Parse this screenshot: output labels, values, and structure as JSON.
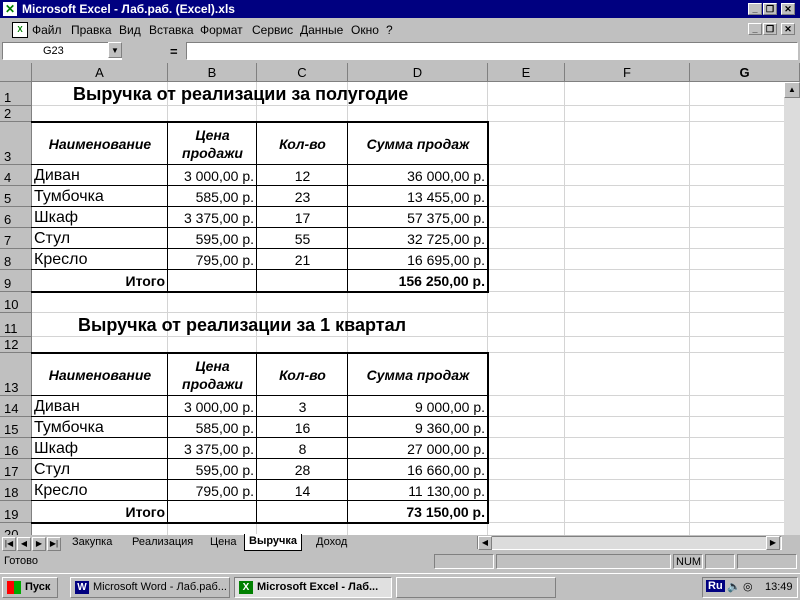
{
  "window": {
    "title": "Microsoft Excel - Лаб.раб. (Excel).xls"
  },
  "menu": [
    "Файл",
    "Правка",
    "Вид",
    "Вставка",
    "Формат",
    "Сервис",
    "Данные",
    "Окно",
    "?"
  ],
  "formula": {
    "cell_ref": "G23",
    "eq": "=",
    "value": ""
  },
  "columns": [
    "A",
    "B",
    "C",
    "D",
    "E",
    "F",
    "G"
  ],
  "rows": [
    "1",
    "2",
    "3",
    "4",
    "5",
    "6",
    "7",
    "8",
    "9",
    "10",
    "11",
    "12",
    "13",
    "14",
    "15",
    "16",
    "17",
    "18",
    "19",
    "20"
  ],
  "table1": {
    "title": "Выручка от реализации за полугодие",
    "headers": [
      "Наименование",
      "Цена продажи",
      "Кол-во",
      "Сумма  продаж"
    ],
    "rows": [
      [
        "Диван",
        "3 000,00 р.",
        "12",
        "36 000,00 р."
      ],
      [
        "Тумбочка",
        "585,00 р.",
        "23",
        "13 455,00 р."
      ],
      [
        "Шкаф",
        "3 375,00 р.",
        "17",
        "57 375,00 р."
      ],
      [
        "Стул",
        "595,00 р.",
        "55",
        "32 725,00 р."
      ],
      [
        "Кресло",
        "795,00 р.",
        "21",
        "16 695,00 р."
      ]
    ],
    "total_label": "Итого",
    "total_value": "156 250,00 р."
  },
  "table2": {
    "title": "Выручка от реализации за 1 квартал",
    "headers": [
      "Наименование",
      "Цена продажи",
      "Кол-во",
      "Сумма  продаж"
    ],
    "rows": [
      [
        "Диван",
        "3 000,00 р.",
        "3",
        "9 000,00 р."
      ],
      [
        "Тумбочка",
        "585,00 р.",
        "16",
        "9 360,00 р."
      ],
      [
        "Шкаф",
        "3 375,00 р.",
        "8",
        "27 000,00 р."
      ],
      [
        "Стул",
        "595,00 р.",
        "28",
        "16 660,00 р."
      ],
      [
        "Кресло",
        "795,00 р.",
        "14",
        "11 130,00 р."
      ]
    ],
    "total_label": "Итого",
    "total_value": "73 150,00 р."
  },
  "sheet_tabs": [
    "Закупка",
    "Реализация",
    "Цена",
    "Выручка",
    "Доход"
  ],
  "active_tab": "Выручка",
  "status": {
    "ready": "Готово",
    "num": "NUM"
  },
  "taskbar": {
    "start": "Пуск",
    "items": [
      "Microsoft Word - Лаб.раб...",
      "Microsoft Excel - Лаб..."
    ],
    "lang": "Ru",
    "clock": "13:49"
  }
}
